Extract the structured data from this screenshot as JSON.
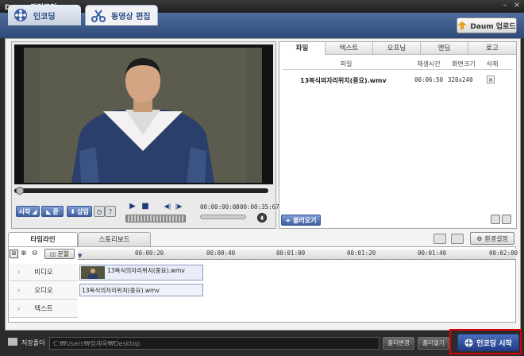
{
  "window": {
    "title": "Daum 팟인코더 ▾",
    "minimize": "–",
    "close": "×"
  },
  "main_tabs": [
    {
      "label": "인코딩"
    },
    {
      "label": "동영상 편집"
    }
  ],
  "upload_button": "Daum 업로드",
  "player": {
    "buttons": {
      "start": "시작",
      "end": "끝",
      "insert": "삽입",
      "help": "?"
    },
    "play": "▶",
    "stop": "■",
    "prev": "◀|",
    "next": "|▶",
    "current_time": "00:00:00:00",
    "total_time": "00:00:35:67"
  },
  "right_tabs": [
    "파일",
    "텍스트",
    "오프닝",
    "엔딩",
    "로고"
  ],
  "file_table": {
    "headers": [
      "파일",
      "재생시간",
      "화면크기",
      "삭제"
    ],
    "rows": [
      {
        "name": "13복식의자리위치(중요).wmv",
        "duration": "00:06:50",
        "size": "320x240",
        "delete": "×"
      }
    ]
  },
  "add_button": "+ 불러오기",
  "timeline_tabs": [
    "타임라인",
    "스토리보드"
  ],
  "settings_button": "환경설정",
  "timeline": {
    "split_label": "분할",
    "ruler_ticks": [
      "00:00:20",
      "00:00:40",
      "00:01:00",
      "00:01:20",
      "00:01:40",
      "00:02:00"
    ],
    "tracks": [
      {
        "label": "비디오"
      },
      {
        "label": "오디오"
      },
      {
        "label": "텍스트"
      }
    ],
    "video_clip": "13복식의자리위치(중요).wmv",
    "audio_clip": "13복식의자리위치(중요).wmv"
  },
  "save": {
    "label": "저장폴더",
    "path": "C:₩Users₩정재욱₩Desktop",
    "change_folder": "폴더변경",
    "open_folder": "폴더열기"
  },
  "encode_button": "인코딩 시작"
}
